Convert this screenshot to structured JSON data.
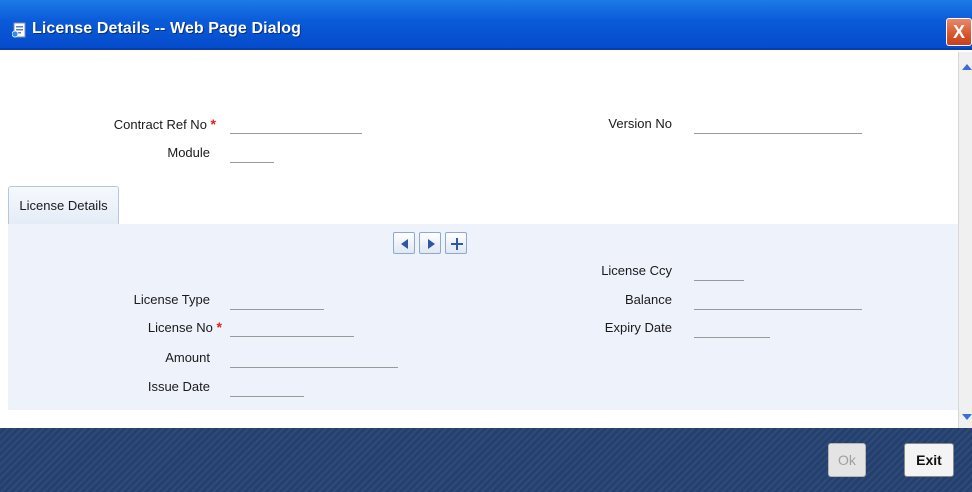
{
  "window": {
    "title": "License Details -- Web Page Dialog",
    "close_glyph": "X"
  },
  "colors": {
    "titlebar": "#0a5ad8",
    "panel": "#eef3fb",
    "footer": "#24406f",
    "required": "#e02020"
  },
  "header_form": {
    "contract_ref_label": "Contract Ref No",
    "contract_ref_value": "",
    "version_label": "Version No",
    "version_value": "",
    "module_label": "Module",
    "module_value": "",
    "required_marker": "*"
  },
  "tabs": [
    {
      "label": "License Details",
      "selected": true
    }
  ],
  "record_nav": {
    "prev_icon": "triangle-left",
    "next_icon": "triangle-right",
    "add_icon": "plus"
  },
  "license": {
    "type_label": "License Type",
    "type_value": "",
    "no_label": "License No",
    "no_value": "",
    "amount_label": "Amount",
    "amount_value": "",
    "issue_date_label": "Issue Date",
    "issue_date_value": "",
    "ccy_label": "License Ccy",
    "ccy_value": "",
    "balance_label": "Balance",
    "balance_value": "",
    "expiry_label": "Expiry Date",
    "expiry_value": ""
  },
  "footer": {
    "ok_label": "Ok",
    "exit_label": "Exit"
  }
}
